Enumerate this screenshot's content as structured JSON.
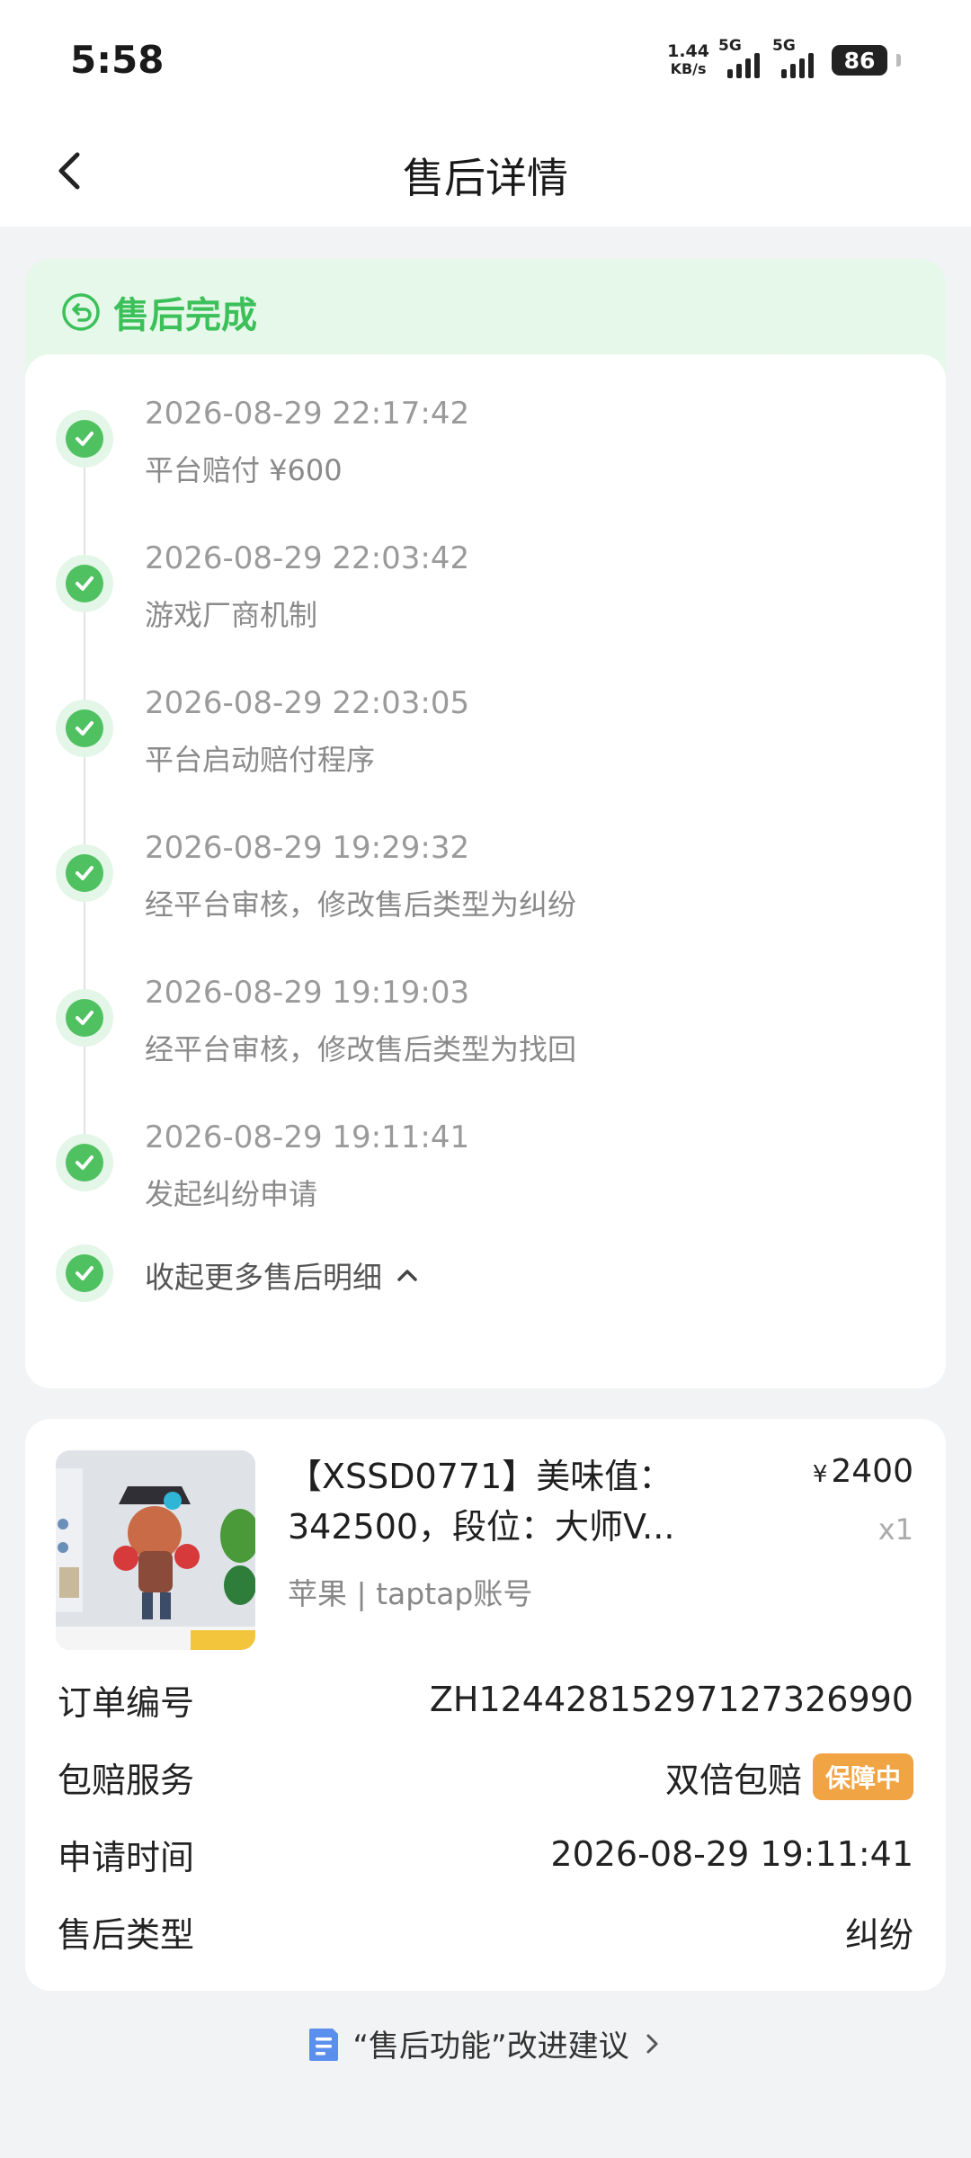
{
  "status_bar": {
    "time": "5:58",
    "net_speed_value": "1.44",
    "net_speed_unit": "KB/s",
    "signal1_label": "5G",
    "signal2_label": "5G",
    "battery": "86"
  },
  "header": {
    "title": "售后详情"
  },
  "status": {
    "label": "售后完成"
  },
  "timeline": [
    {
      "time": "2026-08-29 22:17:42",
      "desc": "平台赔付 ¥600"
    },
    {
      "time": "2026-08-29 22:03:42",
      "desc": "游戏厂商机制"
    },
    {
      "time": "2026-08-29 22:03:05",
      "desc": "平台启动赔付程序"
    },
    {
      "time": "2026-08-29 19:29:32",
      "desc": "经平台审核，修改售后类型为纠纷"
    },
    {
      "time": "2026-08-29 19:19:03",
      "desc": "经平台审核，修改售后类型为找回"
    },
    {
      "time": "2026-08-29 19:11:41",
      "desc": "发起纠纷申请"
    }
  ],
  "collapse_label": "收起更多售后明细",
  "product": {
    "title": "【XSSD0771】美味值：342500，段位：大师V...",
    "price_symbol": "¥",
    "price": "2400",
    "quantity": "x1",
    "subtitle": "苹果 | taptap账号"
  },
  "details": [
    {
      "key": "订单编号",
      "value": "ZH12442815297127326990"
    },
    {
      "key": "包赔服务",
      "value": "双倍包赔",
      "badge": "保障中"
    },
    {
      "key": "申请时间",
      "value": "2026-08-29 19:11:41"
    },
    {
      "key": "售后类型",
      "value": "纠纷"
    }
  ],
  "feedback_label": "“售后功能”改进建议",
  "colors": {
    "accent_green": "#3cc05a",
    "badge_orange": "#f0a444",
    "background": "#f2f3f4"
  }
}
